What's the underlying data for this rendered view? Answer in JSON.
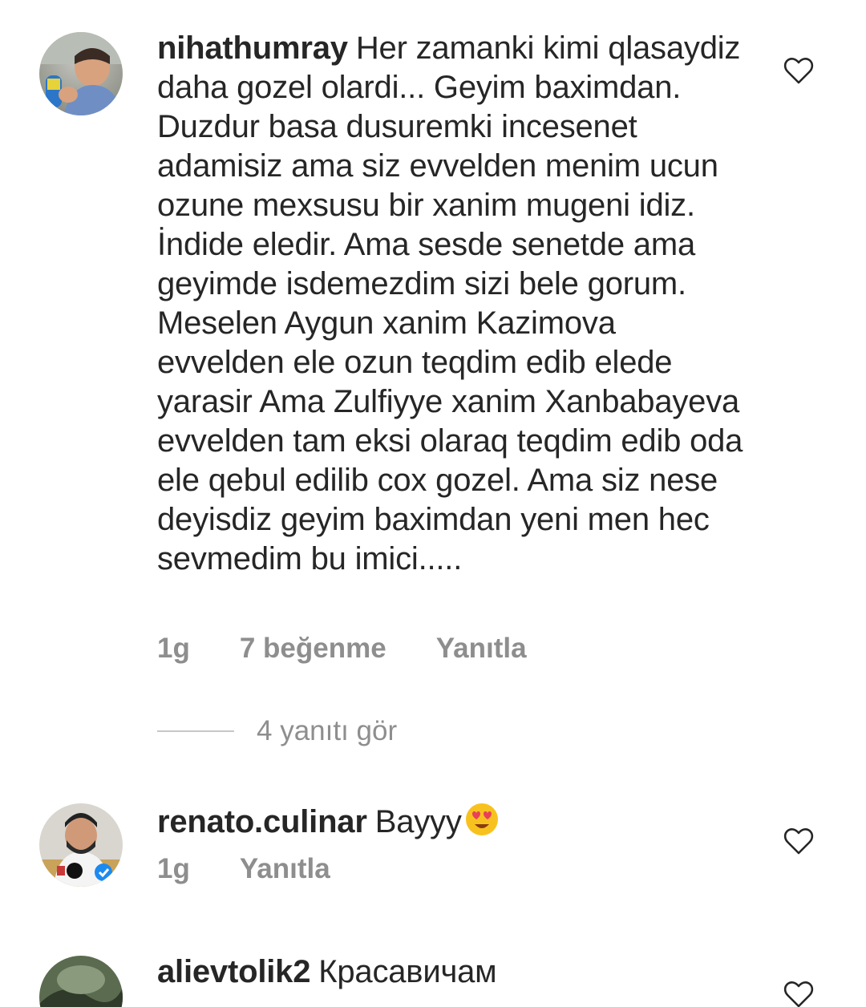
{
  "comments": [
    {
      "username": "nihathumray",
      "text": "Her zamanki kimi qlasaydiz daha gozel olardi... Geyim baximdan. Duzdur basa dusuremki incesenet adamisiz ama siz evvelden menim ucun ozune mexsusu bir xanim mugeni idiz. İndide eledir. Ama sesde senetde ama geyimde isdemezdim sizi bele gorum. Meselen Aygun xanim Kazimova evvelden ele ozun teqdim edib elede yarasir Ama Zulfiyye xanim Xanbabayeva evvelden tam eksi olaraq teqdim edib oda ele qebul edilib cox gozel. Ama siz nese deyisdiz geyim baximdan yeni men hec sevmedim bu imici.....",
      "time": "1g",
      "likes": "7 beğenme",
      "reply": "Yanıtla",
      "view_replies": "4 yanıtı gör"
    },
    {
      "username": "renato.culinar",
      "text": "Bayyy",
      "emoji": "heart-eyes-emoji",
      "time": "1g",
      "reply": "Yanıtla"
    },
    {
      "username": "alievtolik2",
      "text": "Красавичам"
    }
  ],
  "icons": {
    "like": "heart-outline-icon"
  },
  "colors": {
    "text": "#262626",
    "meta": "#8e8e8e",
    "divider": "#c7c7c7"
  }
}
